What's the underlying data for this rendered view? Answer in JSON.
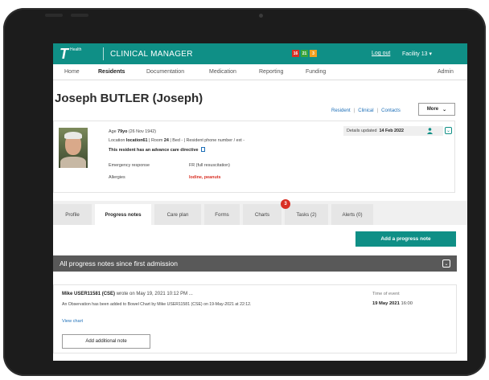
{
  "header": {
    "logo_letter": "T",
    "logo_sub": "Health",
    "app_title": "CLINICAL MANAGER",
    "status_boxes": [
      {
        "label": "16",
        "color": "#d93025"
      },
      {
        "label": "21",
        "color": "#3aa53a"
      },
      {
        "label": "3",
        "color": "#f0a020"
      }
    ],
    "logout": "Log out",
    "facility": "Facility 13"
  },
  "nav": {
    "items": [
      "Home",
      "Residents",
      "Documentation",
      "Medication",
      "Reporting",
      "Funding"
    ],
    "active": "Residents",
    "admin": "Admin"
  },
  "resident": {
    "name": "Joseph BUTLER (Joseph)",
    "links": [
      "Resident",
      "Clinical",
      "Contacts"
    ],
    "more": "More",
    "age_label": "Age",
    "age": "79yo",
    "dob": "(26 Nov 1942)",
    "location_label": "Location",
    "location": "location61",
    "room_label": "Room",
    "room": "24",
    "bed_text": "| Bed - | Resident phone number / ext -",
    "directive": "This resident has an advance care directive",
    "emergency_label": "Emergency response",
    "emergency_value": "FR (full resuscitation)",
    "allergies_label": "Allergies",
    "allergies_value": "Iodine, peanuts",
    "details_label": "Details updated",
    "details_date": "14 Feb 2022"
  },
  "tabs": [
    {
      "label": "Profile"
    },
    {
      "label": "Progress notes"
    },
    {
      "label": "Care plan"
    },
    {
      "label": "Forms"
    },
    {
      "label": "Charts"
    },
    {
      "label": "Tasks (2)"
    },
    {
      "label": "Alerts (0)"
    }
  ],
  "tasks_badge": "3",
  "add_progress_note": "Add a progress note",
  "section_title": "All progress notes since first admission",
  "note": {
    "author": "Mike USER11581 (CSE)",
    "wrote": "wrote on May 19, 2021 10:12 PM ...",
    "text": "An Observation has been added to Bowel Chart by Mike USER11581 (CSE) on 19-May-2021 at 22:12.",
    "view_chart": "View chart",
    "time_label": "Time of event",
    "time_date": "19 May 2021",
    "time_clock": "16:00",
    "add_additional": "Add additional note"
  },
  "colors": {
    "brand": "#0f8f86",
    "alert": "#d93025",
    "link": "#1d6fb8",
    "section": "#595959"
  }
}
